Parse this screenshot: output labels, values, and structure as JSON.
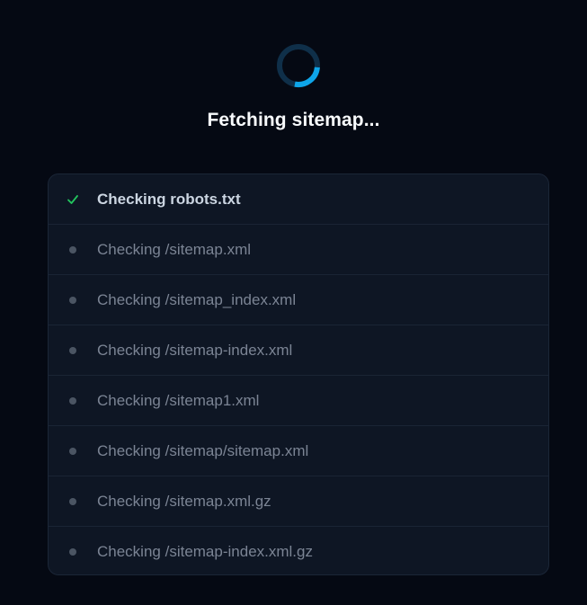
{
  "header": {
    "title": "Fetching sitemap..."
  },
  "colors": {
    "accent": "#0ea5e9",
    "success": "#22c55e",
    "pending_dot": "#4b5563"
  },
  "checks": [
    {
      "label": "Checking robots.txt",
      "status": "done",
      "icon": "check-icon"
    },
    {
      "label": "Checking /sitemap.xml",
      "status": "pending",
      "icon": "dot-icon"
    },
    {
      "label": "Checking /sitemap_index.xml",
      "status": "pending",
      "icon": "dot-icon"
    },
    {
      "label": "Checking /sitemap-index.xml",
      "status": "pending",
      "icon": "dot-icon"
    },
    {
      "label": "Checking /sitemap1.xml",
      "status": "pending",
      "icon": "dot-icon"
    },
    {
      "label": "Checking /sitemap/sitemap.xml",
      "status": "pending",
      "icon": "dot-icon"
    },
    {
      "label": "Checking /sitemap.xml.gz",
      "status": "pending",
      "icon": "dot-icon"
    },
    {
      "label": "Checking /sitemap-index.xml.gz",
      "status": "pending",
      "icon": "dot-icon"
    }
  ]
}
